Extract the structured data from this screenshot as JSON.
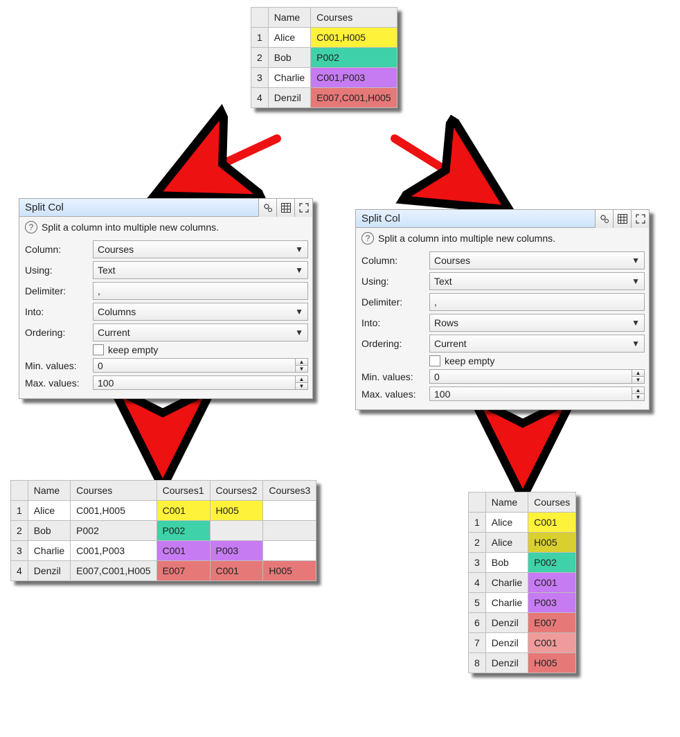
{
  "sourceTable": {
    "headers": [
      "",
      "Name",
      "Courses"
    ],
    "rows": [
      {
        "n": "1",
        "name": "Alice",
        "courses": "C001,H005",
        "color": "#fff23a"
      },
      {
        "n": "2",
        "name": "Bob",
        "courses": "P002",
        "color": "#3fd1a7"
      },
      {
        "n": "3",
        "name": "Charlie",
        "courses": "C001,P003",
        "color": "#c77bf2"
      },
      {
        "n": "4",
        "name": "Denzil",
        "courses": "E007,C001,H005",
        "color": "#e77878"
      }
    ]
  },
  "panelLeft": {
    "title": "Split Col",
    "helpText": "Split a column into multiple new columns.",
    "labels": {
      "column": "Column:",
      "using": "Using:",
      "delimiter": "Delimiter:",
      "into": "Into:",
      "ordering": "Ordering:",
      "keepEmpty": "keep empty",
      "min": "Min. values:",
      "max": "Max. values:"
    },
    "values": {
      "column": "Courses",
      "using": "Text",
      "delimiter": ",",
      "into": "Columns",
      "ordering": "Current",
      "min": "0",
      "max": "100"
    }
  },
  "panelRight": {
    "title": "Split Col",
    "helpText": "Split a column into multiple new columns.",
    "labels": {
      "column": "Column:",
      "using": "Using:",
      "delimiter": "Delimiter:",
      "into": "Into:",
      "ordering": "Ordering:",
      "keepEmpty": "keep empty",
      "min": "Min. values:",
      "max": "Max. values:"
    },
    "values": {
      "column": "Courses",
      "using": "Text",
      "delimiter": ",",
      "into": "Rows",
      "ordering": "Current",
      "min": "0",
      "max": "100"
    }
  },
  "resultLeft": {
    "headers": [
      "",
      "Name",
      "Courses",
      "Courses1",
      "Courses2",
      "Courses3"
    ],
    "rows": [
      {
        "n": "1",
        "name": "Alice",
        "courses": "C001,H005",
        "c1": {
          "v": "C001",
          "bg": "#fff23a"
        },
        "c2": {
          "v": "H005",
          "bg": "#fff23a"
        },
        "c3": {
          "v": "",
          "bg": "#ffffff"
        }
      },
      {
        "n": "2",
        "name": "Bob",
        "courses": "P002",
        "c1": {
          "v": "P002",
          "bg": "#3fd1a7"
        },
        "c2": {
          "v": "",
          "bg": "#ececec"
        },
        "c3": {
          "v": "",
          "bg": "#ececec"
        }
      },
      {
        "n": "3",
        "name": "Charlie",
        "courses": "C001,P003",
        "c1": {
          "v": "C001",
          "bg": "#c77bf2"
        },
        "c2": {
          "v": "P003",
          "bg": "#c77bf2"
        },
        "c3": {
          "v": "",
          "bg": "#ffffff"
        }
      },
      {
        "n": "4",
        "name": "Denzil",
        "courses": "E007,C001,H005",
        "c1": {
          "v": "E007",
          "bg": "#e77878"
        },
        "c2": {
          "v": "C001",
          "bg": "#e77878"
        },
        "c3": {
          "v": "H005",
          "bg": "#e77878"
        }
      }
    ]
  },
  "resultRight": {
    "headers": [
      "",
      "Name",
      "Courses"
    ],
    "rows": [
      {
        "n": "1",
        "name": "Alice",
        "c": {
          "v": "C001",
          "bg": "#fff23a"
        }
      },
      {
        "n": "2",
        "name": "Alice",
        "c": {
          "v": "H005",
          "bg": "#d9cf2e"
        }
      },
      {
        "n": "3",
        "name": "Bob",
        "c": {
          "v": "P002",
          "bg": "#3fd1a7"
        }
      },
      {
        "n": "4",
        "name": "Charlie",
        "c": {
          "v": "C001",
          "bg": "#c77bf2"
        }
      },
      {
        "n": "5",
        "name": "Charlie",
        "c": {
          "v": "P003",
          "bg": "#c77bf2"
        }
      },
      {
        "n": "6",
        "name": "Denzil",
        "c": {
          "v": "E007",
          "bg": "#e77878"
        }
      },
      {
        "n": "7",
        "name": "Denzil",
        "c": {
          "v": "C001",
          "bg": "#ef9b9b"
        }
      },
      {
        "n": "8",
        "name": "Denzil",
        "c": {
          "v": "H005",
          "bg": "#e77878"
        }
      }
    ]
  }
}
